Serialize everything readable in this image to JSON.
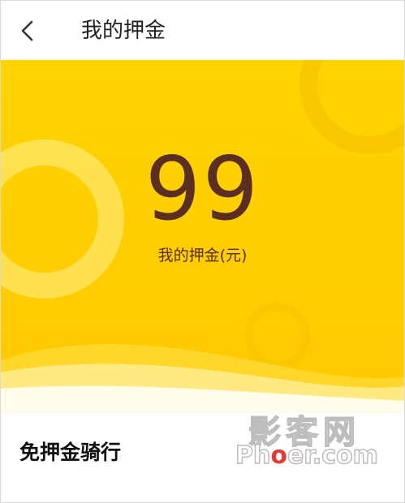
{
  "header": {
    "title": "我的押金",
    "back_icon": "chevron-left-icon"
  },
  "deposit": {
    "amount": "99",
    "label": "我的押金(元)"
  },
  "section": {
    "title": "免押金骑行"
  },
  "watermark": {
    "cn": "影客网",
    "en_prefix": "Ph",
    "en_dot": "o",
    "en_suffix": "er.com"
  },
  "colors": {
    "hero_yellow": "#ffd400",
    "amount_text": "#5a2f22"
  }
}
